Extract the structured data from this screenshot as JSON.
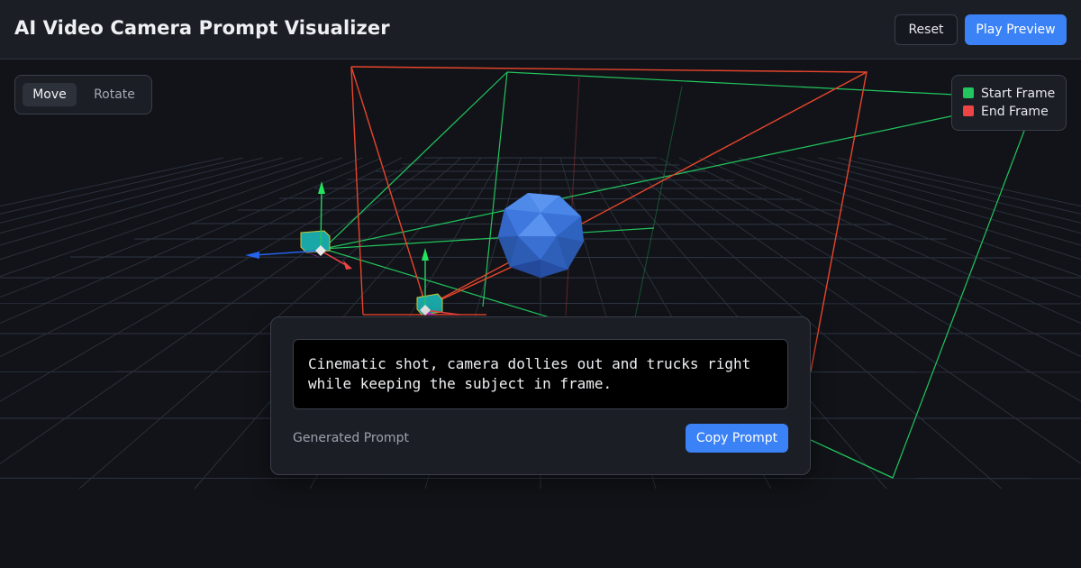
{
  "header": {
    "title": "AI Video Camera Prompt Visualizer",
    "reset_label": "Reset",
    "play_label": "Play Preview"
  },
  "mode": {
    "move_label": "Move",
    "rotate_label": "Rotate",
    "active": "Move"
  },
  "legend": {
    "items": [
      {
        "label": "Start Frame",
        "color": "#22c55e"
      },
      {
        "label": "End Frame",
        "color": "#ef4444"
      }
    ]
  },
  "prompt_panel": {
    "prompt_text": "Cinematic shot, camera dollies out and trucks right while keeping the subject in frame.",
    "label": "Generated Prompt",
    "copy_label": "Copy Prompt"
  },
  "scene": {
    "subject": "icosphere",
    "subject_color": "#3b82f6",
    "start_frustum_color": "#22c55e",
    "end_frustum_color": "#ef4444",
    "gizmo_colors": {
      "x": "#ef4444",
      "y": "#22c55e",
      "z": "#2563eb"
    }
  }
}
